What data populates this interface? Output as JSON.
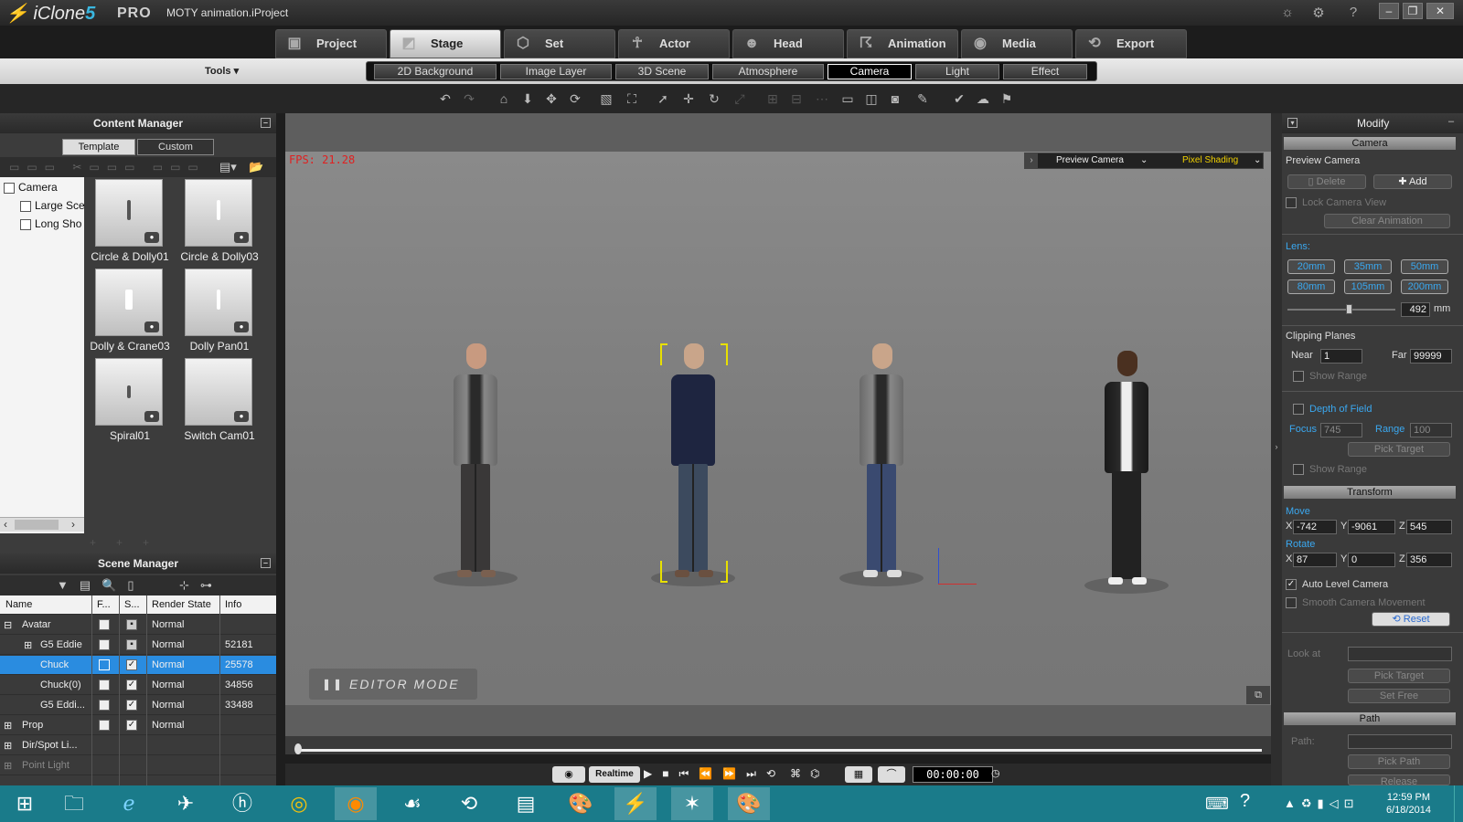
{
  "app": {
    "name": "iClone",
    "version": "5",
    "edition": "PRO",
    "project": "MOTY animation.iProject"
  },
  "main_tabs": [
    {
      "label": "Project",
      "icon": "project-icon"
    },
    {
      "label": "Stage",
      "icon": "stage-icon",
      "active": true
    },
    {
      "label": "Set",
      "icon": "set-icon"
    },
    {
      "label": "Actor",
      "icon": "actor-icon"
    },
    {
      "label": "Head",
      "icon": "head-icon"
    },
    {
      "label": "Animation",
      "icon": "animation-icon"
    },
    {
      "label": "Media",
      "icon": "media-icon"
    },
    {
      "label": "Export",
      "icon": "export-icon"
    }
  ],
  "tools_label": "Tools",
  "sub_tabs": [
    {
      "label": "2D Background"
    },
    {
      "label": "Image Layer"
    },
    {
      "label": "3D Scene"
    },
    {
      "label": "Atmosphere"
    },
    {
      "label": "Camera",
      "active": true
    },
    {
      "label": "Light"
    },
    {
      "label": "Effect"
    }
  ],
  "content_manager": {
    "title": "Content Manager",
    "tabs": [
      "Template",
      "Custom"
    ],
    "tree": [
      "Camera",
      "Large Sce",
      "Long Sho"
    ],
    "items": [
      {
        "label": "Circle & Dolly01"
      },
      {
        "label": "Circle & Dolly03"
      },
      {
        "label": "Dolly & Crane03"
      },
      {
        "label": "Dolly Pan01"
      },
      {
        "label": "Spiral01"
      },
      {
        "label": "Switch Cam01"
      }
    ]
  },
  "scene_manager": {
    "title": "Scene Manager",
    "columns": [
      "Name",
      "F...",
      "S...",
      "Render State",
      "Info"
    ],
    "rows": [
      {
        "name": "Avatar",
        "f": false,
        "s": false,
        "state": "Normal",
        "info": ""
      },
      {
        "name": "G5 Eddie",
        "f": false,
        "s": false,
        "state": "Normal",
        "info": "52181"
      },
      {
        "name": "Chuck",
        "f": false,
        "s": true,
        "state": "Normal",
        "info": "25578",
        "selected": true
      },
      {
        "name": "Chuck(0)",
        "f": false,
        "s": true,
        "state": "Normal",
        "info": "34856"
      },
      {
        "name": "G5 Eddi...",
        "f": false,
        "s": true,
        "state": "Normal",
        "info": "33488"
      },
      {
        "name": "Prop",
        "f": false,
        "s": true,
        "state": "Normal",
        "info": ""
      },
      {
        "name": "Dir/Spot Li...",
        "f": null,
        "s": null,
        "state": "",
        "info": ""
      },
      {
        "name": "Point Light",
        "f": null,
        "s": null,
        "state": "",
        "info": ""
      }
    ]
  },
  "viewport": {
    "fps": "FPS: 21.28",
    "camera": "Preview Camera",
    "shading": "Pixel Shading",
    "mode": "EDITOR MODE"
  },
  "playback": {
    "realtime": "Realtime",
    "time": "00:00:00"
  },
  "modify": {
    "title": "Modify",
    "camera_section": "Camera",
    "preview_camera": "Preview Camera",
    "delete": "Delete",
    "add": "Add",
    "lock_camera": "Lock Camera View",
    "clear_animation": "Clear Animation",
    "lens_label": "Lens:",
    "lenses": [
      "20mm",
      "35mm",
      "50mm",
      "80mm",
      "105mm",
      "200mm"
    ],
    "lens_value": "492",
    "lens_unit": "mm",
    "clipping": "Clipping Planes",
    "near_label": "Near",
    "near": "1",
    "far_label": "Far",
    "far": "99999",
    "show_range": "Show Range",
    "dof": "Depth of Field",
    "focus_label": "Focus",
    "focus": "745",
    "range_label": "Range",
    "range": "100",
    "pick_target": "Pick Target",
    "transform": "Transform",
    "move": "Move",
    "move_x": "-742",
    "move_y": "-9061",
    "move_z": "545",
    "rotate": "Rotate",
    "rot_x": "87",
    "rot_y": "0",
    "rot_z": "356",
    "auto_level": "Auto Level Camera",
    "smooth": "Smooth Camera Movement",
    "reset": "Reset",
    "look_at": "Look at",
    "set_free": "Set Free",
    "path_section": "Path",
    "path_label": "Path:",
    "pick_path": "Pick Path",
    "release": "Release"
  },
  "taskbar": {
    "time": "12:59 PM",
    "date": "6/18/2014"
  },
  "colors": {
    "accent": "#3aa8f0",
    "selection": "#2a8ce0",
    "fps": "#e02020",
    "taskbar": "#1a7b8a"
  }
}
